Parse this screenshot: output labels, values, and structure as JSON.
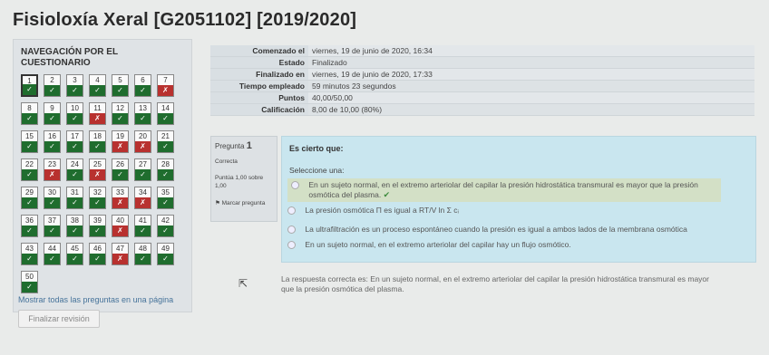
{
  "page_title": "Fisioloxía Xeral [G2051102] [2019/2020]",
  "nav": {
    "title": "NAVEGACIÓN POR EL CUESTIONARIO",
    "show_all": "Mostrar todas las preguntas en una página",
    "finish": "Finalizar revisión",
    "questions": [
      {
        "n": "1",
        "s": "correct"
      },
      {
        "n": "2",
        "s": "correct"
      },
      {
        "n": "3",
        "s": "correct"
      },
      {
        "n": "4",
        "s": "correct"
      },
      {
        "n": "5",
        "s": "correct"
      },
      {
        "n": "6",
        "s": "correct"
      },
      {
        "n": "7",
        "s": "wrong"
      },
      {
        "n": "8",
        "s": "correct"
      },
      {
        "n": "9",
        "s": "correct"
      },
      {
        "n": "10",
        "s": "correct"
      },
      {
        "n": "11",
        "s": "wrong"
      },
      {
        "n": "12",
        "s": "correct"
      },
      {
        "n": "13",
        "s": "correct"
      },
      {
        "n": "14",
        "s": "correct"
      },
      {
        "n": "15",
        "s": "correct"
      },
      {
        "n": "16",
        "s": "correct"
      },
      {
        "n": "17",
        "s": "correct"
      },
      {
        "n": "18",
        "s": "correct"
      },
      {
        "n": "19",
        "s": "wrong"
      },
      {
        "n": "20",
        "s": "wrong"
      },
      {
        "n": "21",
        "s": "correct"
      },
      {
        "n": "22",
        "s": "correct"
      },
      {
        "n": "23",
        "s": "wrong"
      },
      {
        "n": "24",
        "s": "correct"
      },
      {
        "n": "25",
        "s": "wrong"
      },
      {
        "n": "26",
        "s": "correct"
      },
      {
        "n": "27",
        "s": "correct"
      },
      {
        "n": "28",
        "s": "correct"
      },
      {
        "n": "29",
        "s": "correct"
      },
      {
        "n": "30",
        "s": "correct"
      },
      {
        "n": "31",
        "s": "correct"
      },
      {
        "n": "32",
        "s": "correct"
      },
      {
        "n": "33",
        "s": "wrong"
      },
      {
        "n": "34",
        "s": "wrong"
      },
      {
        "n": "35",
        "s": "correct"
      },
      {
        "n": "36",
        "s": "correct"
      },
      {
        "n": "37",
        "s": "correct"
      },
      {
        "n": "38",
        "s": "correct"
      },
      {
        "n": "39",
        "s": "correct"
      },
      {
        "n": "40",
        "s": "wrong"
      },
      {
        "n": "41",
        "s": "correct"
      },
      {
        "n": "42",
        "s": "correct"
      },
      {
        "n": "43",
        "s": "correct"
      },
      {
        "n": "44",
        "s": "correct"
      },
      {
        "n": "45",
        "s": "correct"
      },
      {
        "n": "46",
        "s": "correct"
      },
      {
        "n": "47",
        "s": "wrong"
      },
      {
        "n": "48",
        "s": "correct"
      },
      {
        "n": "49",
        "s": "correct"
      },
      {
        "n": "50",
        "s": "correct"
      }
    ],
    "tick_symbol": "✓",
    "cross_symbol": "✗"
  },
  "summary": [
    {
      "k": "Comenzado el",
      "v": "viernes, 19 de junio de 2020, 16:34"
    },
    {
      "k": "Estado",
      "v": "Finalizado"
    },
    {
      "k": "Finalizado en",
      "v": "viernes, 19 de junio de 2020, 17:33"
    },
    {
      "k": "Tiempo empleado",
      "v": "59 minutos 23 segundos"
    },
    {
      "k": "Puntos",
      "v": "40,00/50,00"
    },
    {
      "k": "Calificación",
      "v": "8,00 de 10,00 (80%)"
    }
  ],
  "question": {
    "label": "Pregunta",
    "number": "1",
    "state": "Correcta",
    "grade": "Puntúa 1,00 sobre 1,00",
    "flag": "Marcar pregunta",
    "text": "Es cierto que:",
    "prompt": "Seleccione una:",
    "answers": [
      "En un sujeto normal, en el extremo arteriolar del capilar la presión hidrostática transmural es mayor que la presión osmótica del plasma.",
      "La presión osmótica Π es igual a RT/V ln Σ cᵢ",
      "La ultrafiltración es un proceso espontáneo cuando la presión es igual a ambos lados de la membrana osmótica",
      "En un sujeto normal, en el extremo arteriolar del capilar hay un flujo osmótico."
    ],
    "feedback": "La respuesta correcta es: En un sujeto normal, en el extremo arteriolar del capilar la presión hidrostática transmural es mayor que la presión osmótica del plasma."
  }
}
